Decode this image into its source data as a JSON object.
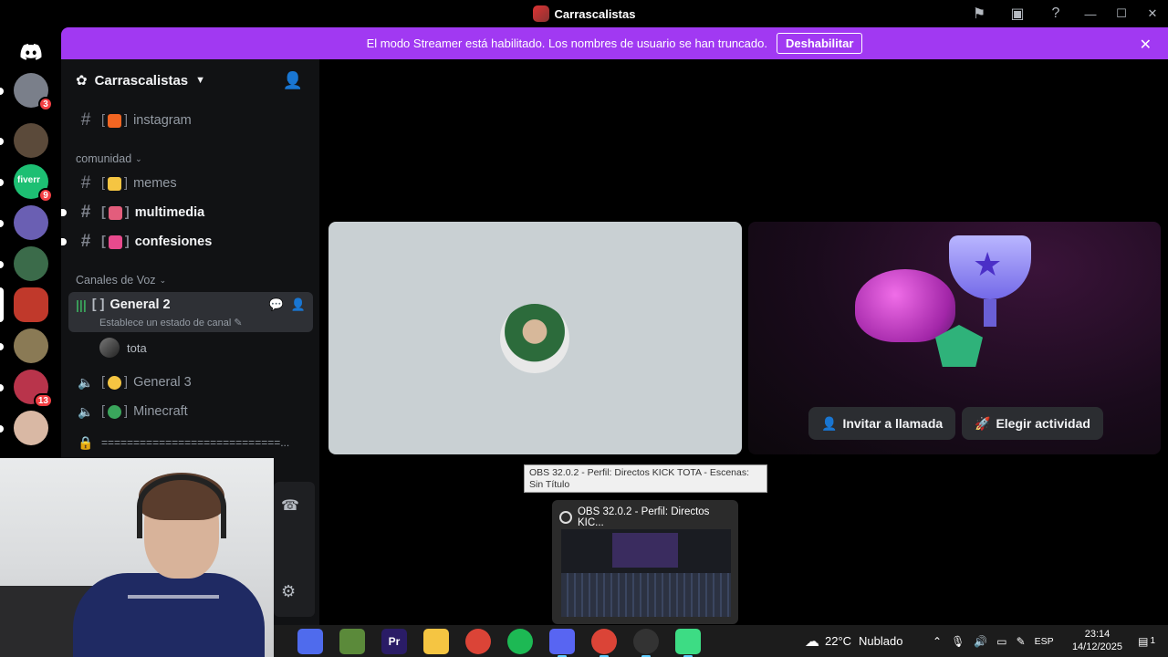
{
  "window": {
    "title": "Carrascalistas"
  },
  "banner": {
    "message": "El modo Streamer está habilitado. Los nombres de usuario se han truncado.",
    "button": "Deshabilitar"
  },
  "rail": {
    "servers": [
      {
        "badge": "3",
        "color": "#7a7f8a"
      },
      {
        "badge": "",
        "color": "#5b4a3a"
      },
      {
        "badge": "9",
        "color": "#1dbf73",
        "label": "fiverr"
      },
      {
        "badge": "",
        "color": "#6a5fb3"
      },
      {
        "badge": "",
        "color": "#3b6b4a"
      },
      {
        "badge": "",
        "color": "#c0392b",
        "active": true
      },
      {
        "badge": "",
        "color": "#8a7a55"
      },
      {
        "badge": "13",
        "color": "#b9344b"
      },
      {
        "badge": "",
        "color": "#d9b8a4"
      }
    ]
  },
  "sidebar": {
    "guild_name": "Carrascalistas",
    "top_channel": {
      "name": "instagram",
      "emoji_color": "#f26522"
    },
    "category_comunidad": "comunidad",
    "text_channels": [
      {
        "name": "memes",
        "emoji_color": "#f5c542",
        "unread": false
      },
      {
        "name": "multimedia",
        "emoji_color": "#e35d7c",
        "unread": true
      },
      {
        "name": "confesiones",
        "emoji_color": "#e84a8d",
        "unread": true
      }
    ],
    "category_voz": "Canales de Voz",
    "active_voice": {
      "name": "General 2",
      "status": "Establece un estado de canal"
    },
    "member": "tota",
    "voice_channels": [
      {
        "name": "General 3",
        "emoji_color": "#f5c542"
      },
      {
        "name": "Minecraft",
        "emoji_color": "#3aa55c"
      }
    ],
    "locked_channel": "============================..."
  },
  "call": {
    "invite_button": "Invitar a llamada",
    "activity_button": "Elegir actividad"
  },
  "obs": {
    "tooltip": "OBS 32.0.2 - Perfil: Directos KICK TOTA - Escenas: Sin Título",
    "thumb_title": "OBS 32.0.2 - Perfil: Directos KIC..."
  },
  "taskbar": {
    "apps": [
      {
        "name": "copilot",
        "color": "#4f6bed",
        "label": ""
      },
      {
        "name": "minecraft",
        "color": "#5b8a3a",
        "label": ""
      },
      {
        "name": "premiere",
        "color": "#2a1c66",
        "label": "Pr"
      },
      {
        "name": "explorer",
        "color": "#f5c542",
        "label": ""
      },
      {
        "name": "chrome",
        "color": "#db4437",
        "label": ""
      },
      {
        "name": "spotify",
        "color": "#1db954",
        "label": ""
      },
      {
        "name": "discord",
        "color": "#5865f2",
        "label": "",
        "active": true
      },
      {
        "name": "chrome-2",
        "color": "#db4437",
        "label": "",
        "active": true
      },
      {
        "name": "obs",
        "color": "#333333",
        "label": "",
        "active": true
      },
      {
        "name": "android",
        "color": "#3ddc84",
        "label": "",
        "active": true
      }
    ],
    "weather": {
      "temp": "22°C",
      "desc": "Nublado"
    },
    "lang": "ESP",
    "time": "23:14",
    "date": "14/12/2025",
    "notif_count": "1"
  }
}
